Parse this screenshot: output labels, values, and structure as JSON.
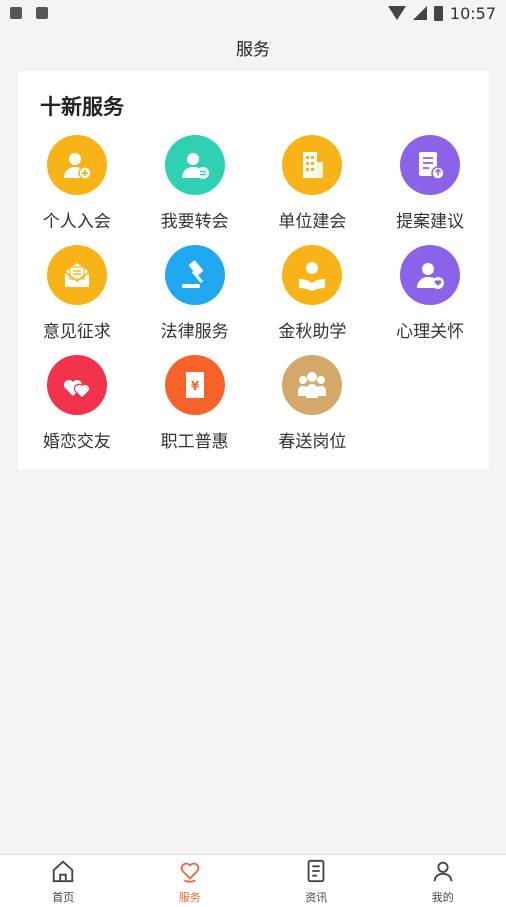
{
  "status_bar": {
    "time": "10:57"
  },
  "header": {
    "title": "服务"
  },
  "section": {
    "title": "十新服务"
  },
  "services": [
    {
      "label": "个人入会",
      "icon": "person-add-icon",
      "color": "#f8b318"
    },
    {
      "label": "我要转会",
      "icon": "person-transfer-icon",
      "color": "#2fd0b4"
    },
    {
      "label": "单位建会",
      "icon": "building-icon",
      "color": "#f8b318"
    },
    {
      "label": "提案建议",
      "icon": "proposal-doc-icon",
      "color": "#8a63e8"
    },
    {
      "label": "意见征求",
      "icon": "mail-icon",
      "color": "#f8b318"
    },
    {
      "label": "法律服务",
      "icon": "gavel-icon",
      "color": "#1fa8ef"
    },
    {
      "label": "金秋助学",
      "icon": "student-book-icon",
      "color": "#f8b318"
    },
    {
      "label": "心理关怀",
      "icon": "person-heart-icon",
      "color": "#8a63e8"
    },
    {
      "label": "婚恋交友",
      "icon": "hearts-icon",
      "color": "#f0324a"
    },
    {
      "label": "职工普惠",
      "icon": "voucher-icon",
      "color": "#f5632b"
    },
    {
      "label": "春送岗位",
      "icon": "team-icon",
      "color": "#d4a86a"
    }
  ],
  "tabs": [
    {
      "label": "首页",
      "icon": "home-icon",
      "active": false
    },
    {
      "label": "服务",
      "icon": "service-heart-icon",
      "active": true
    },
    {
      "label": "资讯",
      "icon": "news-doc-icon",
      "active": false
    },
    {
      "label": "我的",
      "icon": "user-icon",
      "active": false
    }
  ],
  "colors": {
    "accent": "#f06a3c",
    "background": "#f4f4f4"
  }
}
